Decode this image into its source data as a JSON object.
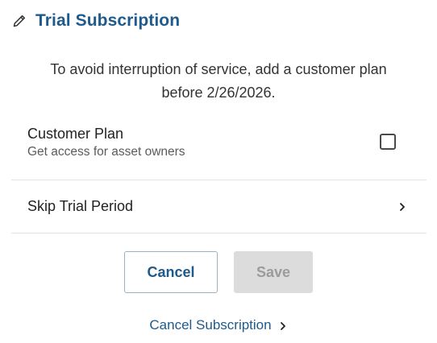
{
  "header": {
    "icon": "pencil-icon",
    "title": "Trial Subscription"
  },
  "notice": {
    "line1": "To avoid interruption of service, add a customer plan",
    "line2": "before 2/26/2026."
  },
  "customer_plan": {
    "title": "Customer Plan",
    "subtitle": "Get access for asset owners",
    "checked": false
  },
  "skip_trial": {
    "label": "Skip Trial Period",
    "icon": "chevron-right-icon"
  },
  "actions": {
    "cancel_label": "Cancel",
    "save_label": "Save",
    "save_disabled": true
  },
  "footer": {
    "cancel_subscription_label": "Cancel Subscription",
    "icon": "chevron-right-icon"
  },
  "colors": {
    "brand": "#1f5a8c",
    "disabled_bg": "#dcdcdc",
    "disabled_text": "#9b9b9b",
    "divider": "#e3e3e3"
  }
}
